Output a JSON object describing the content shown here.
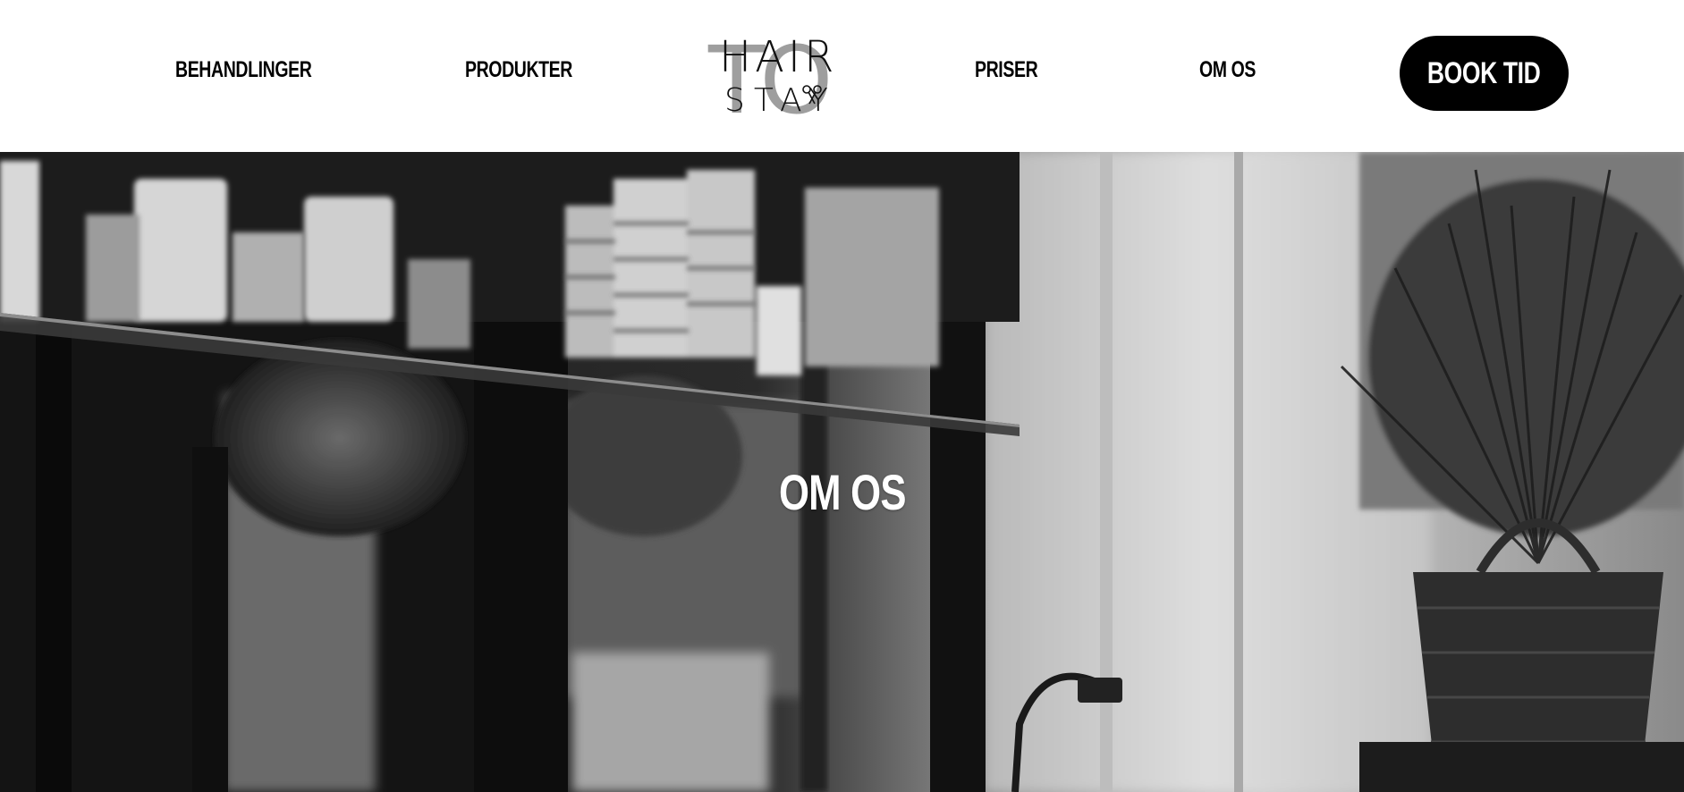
{
  "nav": {
    "items": [
      {
        "label": "BEHANDLINGER"
      },
      {
        "label": "PRODUKTER"
      },
      {
        "label": "PRISER"
      },
      {
        "label": "OM OS"
      }
    ]
  },
  "logo": {
    "line1": "HAIR",
    "line2": "STAY",
    "mark": "TO",
    "icon": "scissors-icon"
  },
  "book_button": {
    "label": "BOOK TID"
  },
  "hero": {
    "title": "OM OS",
    "image": "salon-interior-black-and-white-photo"
  },
  "colors": {
    "background": "#ffffff",
    "text": "#000000",
    "button_bg": "#000000",
    "button_text": "#ffffff"
  }
}
